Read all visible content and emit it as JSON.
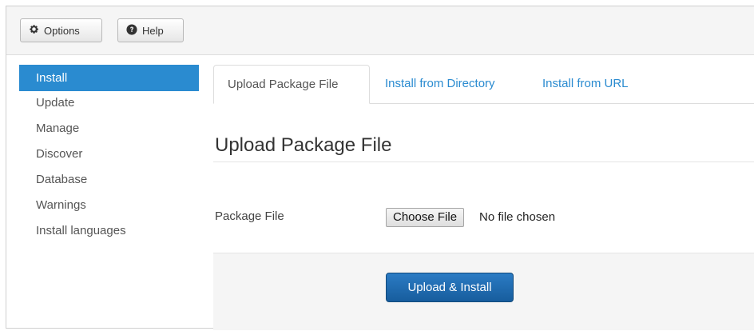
{
  "toolbar": {
    "options_label": "Options",
    "help_label": "Help"
  },
  "sidebar": {
    "items": [
      {
        "label": "Install",
        "active": true
      },
      {
        "label": "Update"
      },
      {
        "label": "Manage"
      },
      {
        "label": "Discover"
      },
      {
        "label": "Database"
      },
      {
        "label": "Warnings"
      },
      {
        "label": "Install languages"
      }
    ]
  },
  "tabs": [
    {
      "label": "Upload Package File",
      "active": true
    },
    {
      "label": "Install from Directory"
    },
    {
      "label": "Install from URL"
    }
  ],
  "main": {
    "section_title": "Upload Package File",
    "package_file_label": "Package File",
    "choose_file_label": "Choose File",
    "file_status": "No file chosen",
    "submit_label": "Upload & Install"
  },
  "colors": {
    "accent": "#2a8bd0",
    "primary_button": "#1f6cb0",
    "toolbar_bg": "#f5f5f5"
  },
  "icons": {
    "options": "gear-icon",
    "help": "question-circle-icon"
  }
}
